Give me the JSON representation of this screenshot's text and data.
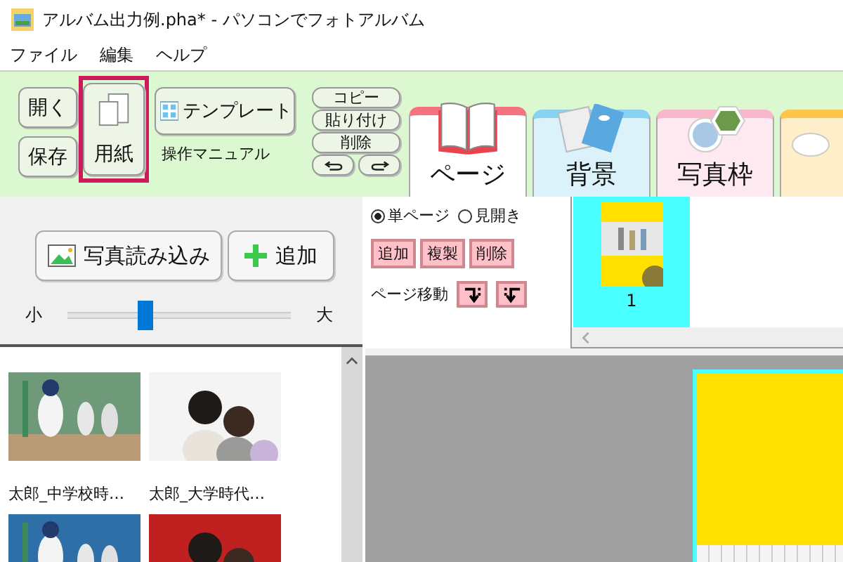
{
  "window": {
    "title": "アルバム出力例.pha* - パソコンでフォトアルバム"
  },
  "menu": [
    {
      "label": "ファイル"
    },
    {
      "label": "編集"
    },
    {
      "label": "ヘルプ"
    }
  ],
  "toolbar": {
    "open_button": "開く",
    "save_button": "保存",
    "paper_button": {
      "label": "用紙",
      "selected": true
    },
    "template_button": "テンプレート",
    "manual_link": "操作マニュアル",
    "edit_buttons": [
      "コピー",
      "貼り付け",
      "削除"
    ]
  },
  "tabs": [
    {
      "label": "ページ",
      "selected": true,
      "color": "#f4737f"
    },
    {
      "label": "背景",
      "selected": false,
      "color": "#86d2f0"
    },
    {
      "label": "写真枠",
      "selected": false,
      "color": "#f8b6cb"
    },
    {
      "selected": false,
      "color": "#fcc64a"
    }
  ],
  "photo_panel": {
    "import_button": "写真読み込み",
    "add_button": "追加",
    "size_min": "小",
    "size_max": "大",
    "size_slider": {
      "level": 0.35
    },
    "photos": [
      {
        "kind": "picture",
        "caption": "太郎_中学校時…"
      },
      {
        "kind": "picture",
        "caption": "太郎_大学時代…"
      },
      {
        "kind": "picture"
      },
      {
        "kind": "picture"
      }
    ]
  },
  "page_panel": {
    "layouts": [
      {
        "label": "単ページ",
        "selected": true
      },
      {
        "label": "見開き",
        "selected": false
      }
    ],
    "page_buttons": [
      "追加",
      "複製",
      "削除"
    ],
    "move_label": "ページ移動"
  },
  "page_strip": [
    {
      "number": "1",
      "selected": true
    }
  ]
}
